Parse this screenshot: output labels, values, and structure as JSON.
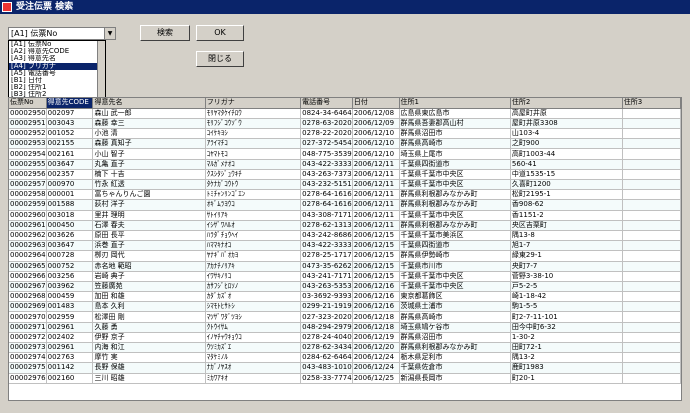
{
  "window": {
    "title": "受注伝票 検索"
  },
  "filter": {
    "selected": "[A1] 伝票No",
    "options": [
      "[A1] 伝票No",
      "[A2] 得意先CODE",
      "[A3] 得意先名",
      "[A4] フリガナ",
      "[A5] 電話番号",
      "[B1] 日付",
      "[B2] 住所1",
      "[B3] 住所2"
    ],
    "highlighted_index": 3
  },
  "buttons": {
    "search": "検索",
    "ok": "OK",
    "close": "閉じる"
  },
  "table": {
    "columns": [
      "伝票No",
      "得意先CODE",
      "得意先名",
      "フリガナ",
      "電話番号",
      "日付",
      "住所1",
      "住所2",
      "住所3"
    ],
    "rows": [
      [
        "00002950",
        "002097",
        "森山 武一郎",
        "ﾓﾘﾔﾏﾀｹｲﾁﾛｳ",
        "0824-34-6464",
        "2006/12/08",
        "広島県東広島市",
        "高屋町井原"
      ],
      [
        "00002951",
        "003043",
        "森藤 幸三",
        "ﾓﾘﾌｼﾞｺｳｿﾞｳ",
        "0278-63-2020",
        "2006/12/09",
        "群馬県吾妻郡高山村",
        "屋町井原3308"
      ],
      [
        "00002952",
        "001052",
        "小池 清",
        "ｺｲｹｷﾖｼ",
        "0278-22-2020",
        "2006/12/10",
        "群馬県沼田市",
        "山103-4"
      ],
      [
        "00002953",
        "002155",
        "森藤 真知子",
        "ｱﾗｲﾏﾁｺ",
        "027-372-5454",
        "2006/12/10",
        "群馬県高崎市",
        "之町900"
      ],
      [
        "00002954",
        "002161",
        "小山 智子",
        "ｺﾔﾏﾄﾓｺ",
        "048-775-3539",
        "2006/12/10",
        "埼玉県上尾市",
        "高町1003-44"
      ],
      [
        "00002955",
        "003647",
        "丸亀 直子",
        "ﾏﾙｶﾞﾒﾅｵｺ",
        "043-422-3333",
        "2006/12/11",
        "千葉県四街道市",
        "560-41"
      ],
      [
        "00002956",
        "002357",
        "楠下 十吉",
        "ｸｽｼﾀｼﾞｭｳｷﾁ",
        "043-263-7373",
        "2006/12/11",
        "千葉県千葉市中央区",
        "中道1535-15"
      ],
      [
        "00002957",
        "000970",
        "竹永 紅透",
        "ﾀｹﾅｶﾞｺｳﾄｳ",
        "043-232-5151",
        "2006/12/11",
        "千葉県千葉市中央区",
        "久喜町1200"
      ],
      [
        "00002958",
        "000001",
        "富ちゃんりんご園",
        "ﾄﾐﾁｬﾝﾘﾝｺﾞｴﾝ",
        "0278-64-1616",
        "2006/12/11",
        "群馬県利根郡みなかみ町",
        "松町2195-1"
      ],
      [
        "00002959",
        "001588",
        "荻村 洋子",
        "ｵｷﾞﾑﾗﾖｳｺ",
        "0278-64-1616",
        "2006/12/11",
        "群馬県利根郡みなかみ町",
        "香908-62"
      ],
      [
        "00002960",
        "003018",
        "里井 理明",
        "ｻﾄｲﾘｱｷ",
        "043-308-7171",
        "2006/12/11",
        "千葉県千葉市中央区",
        "香1151-2"
      ],
      [
        "00002961",
        "000450",
        "石澤 春夫",
        "ｲｼｻﾞﾜﾊﾙｵ",
        "0278-62-1313",
        "2006/12/11",
        "群馬県利根郡みなかみ町",
        "央区吉栗町"
      ],
      [
        "00002962",
        "003626",
        "原田 長平",
        "ﾊﾗﾀﾞﾁｮｳﾍｲ",
        "043-242-8686",
        "2006/12/15",
        "千葉県千葉市美浜区",
        "隅13-8"
      ],
      [
        "00002963",
        "003647",
        "浜巻 直子",
        "ﾊﾏﾏｷﾅｵｺ",
        "043-422-3333",
        "2006/12/15",
        "千葉県四街道市",
        "旭1-7"
      ],
      [
        "00002964",
        "000728",
        "栁刃 岡代",
        "ﾔﾅｷﾞﾊﾞｵｶﾖ",
        "0278-25-1717",
        "2006/12/15",
        "群馬県伊勢崎市",
        "緑東29-1"
      ],
      [
        "00002965",
        "000752",
        "赤名地 範昭",
        "ｱｶﾅﾁﾉﾘｱｷ",
        "0473-35-6262",
        "2006/12/15",
        "千葉県市川市",
        "央町7-7"
      ],
      [
        "00002966",
        "003256",
        "岩崎 典子",
        "ｲﾜｻｷﾉﾘｺ",
        "043-241-7171",
        "2006/12/15",
        "千葉県千葉市中央区",
        "菅野3-38-10"
      ],
      [
        "00002967",
        "003962",
        "笠藤廣苑",
        "ｶｻﾌｼﾞﾋﾛｿﾉ",
        "043-263-5353",
        "2006/12/16",
        "千葉県千葉市中央区",
        "戸5-2-5"
      ],
      [
        "00002968",
        "000459",
        "加田 和雄",
        "ｶﾀﾞｶｽﾞｵ",
        "03-3692-9393",
        "2006/12/16",
        "東京都葛飾区",
        "崎1-18-42"
      ],
      [
        "00002969",
        "001483",
        "島本 久利",
        "ｼﾏﾓﾄﾋｻﾄｼ",
        "0299-21-1919",
        "2006/12/16",
        "茨城県土浦市",
        "駒1-5-5"
      ],
      [
        "00002970",
        "002959",
        "松澤田 剛",
        "ﾏﾂｻﾞﾜﾀﾞﾂﾖｼ",
        "027-323-2020",
        "2006/12/18",
        "群馬県高崎市",
        "町2-7-11-101"
      ],
      [
        "00002971",
        "002961",
        "久藤 勇",
        "ｸﾄｳｲｻﾑ",
        "048-294-2979",
        "2006/12/18",
        "埼玉県鳩ケ谷市",
        "田今中町6-32"
      ],
      [
        "00002972",
        "002402",
        "伊野 京子",
        "ｲﾉﾔﾁｬｳｷｮｳｺ",
        "0278-24-4040",
        "2006/12/19",
        "群馬県沼田市",
        "1-30-2"
      ],
      [
        "00002973",
        "002961",
        "内海 和江",
        "ｳﾂﾐｶｽﾞｴ",
        "0278-62-3434",
        "2006/12/20",
        "群馬県利根郡みなかみ町",
        "田町72-1"
      ],
      [
        "00002974",
        "002763",
        "摩竹 実",
        "ﾏﾀｹﾐﾉﾙ",
        "0284-62-6464",
        "2006/12/24",
        "栃木県足利市",
        "隅13-2"
      ],
      [
        "00002975",
        "001142",
        "長野 保雄",
        "ﾅｶﾞﾉﾔｽｵ",
        "043-483-1010",
        "2006/12/24",
        "千葉県佐倉市",
        "鹿町1983"
      ],
      [
        "00002976",
        "002160",
        "三川 昭雄",
        "ﾐｶﾜｱｷｵ",
        "0258-33-7774",
        "2006/12/25",
        "新潟県長岡市",
        "町20-1"
      ]
    ]
  }
}
